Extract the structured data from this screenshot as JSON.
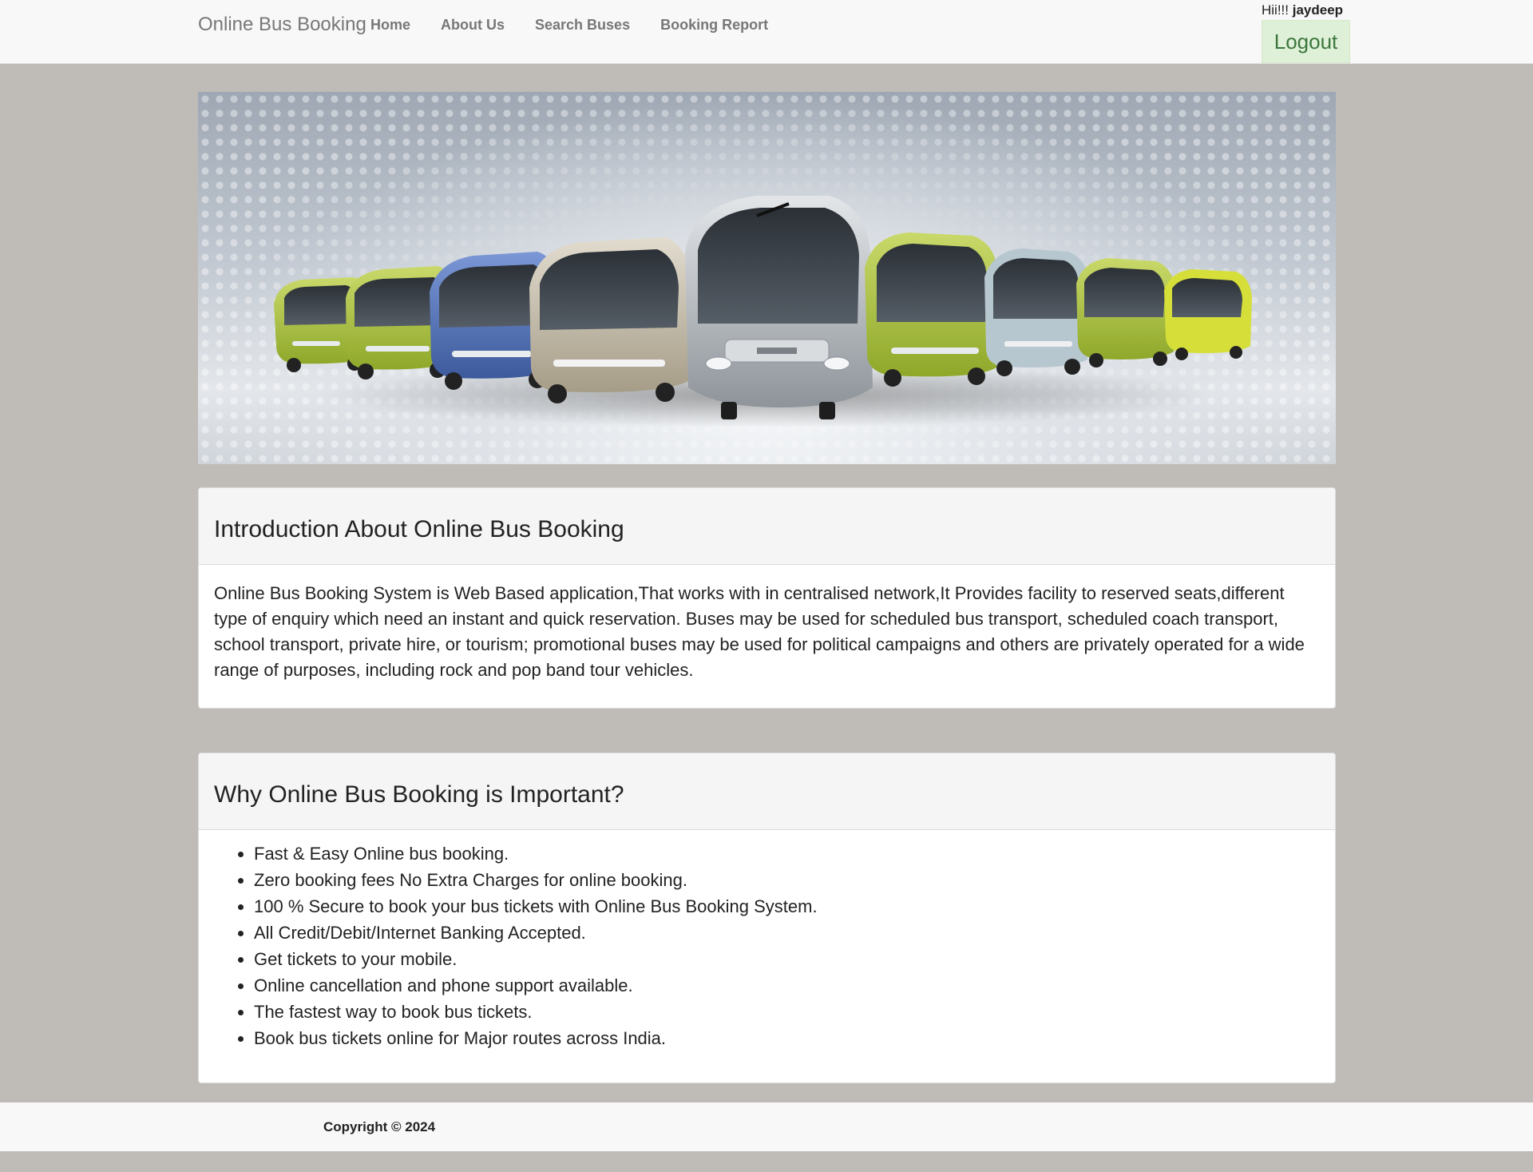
{
  "navbar": {
    "brand": "Online Bus Booking",
    "links": [
      "Home",
      "About Us",
      "Search Buses",
      "Booking Report"
    ],
    "greeting_prefix": "Hii!!!",
    "username": "jaydeep",
    "logout_label": "Logout"
  },
  "banner": {
    "alt": "Fleet of buses"
  },
  "intro": {
    "title": "Introduction About Online Bus Booking",
    "body": "Online Bus Booking System is Web Based application,That works with in centralised network,It Provides facility to reserved seats,different type of enquiry which need an instant and quick reservation. Buses may be used for scheduled bus transport, scheduled coach transport, school transport, private hire, or tourism; promotional buses may be used for political campaigns and others are privately operated for a wide range of purposes, including rock and pop band tour vehicles."
  },
  "why": {
    "title": "Why Online Bus Booking is Important?",
    "items": [
      "Fast & Easy Online bus booking.",
      "Zero booking fees No Extra Charges for online booking.",
      "100 % Secure to book your bus tickets with Online Bus Booking System.",
      "All Credit/Debit/Internet Banking Accepted.",
      "Get tickets to your mobile.",
      "Online cancellation and phone support available.",
      "The fastest way to book bus tickets.",
      "Book bus tickets online for Major routes across India."
    ]
  },
  "footer": {
    "copyright": "Copyright © 2024"
  },
  "colors": {
    "page_background": "#bfbbb7",
    "navbar_background": "#f8f8f8",
    "logout_background": "#dff0d8",
    "logout_text": "#3c763d",
    "bus_lime": "#a8c23a",
    "bus_blue": "#4e6fb5",
    "bus_silver": "#bfc3c7"
  }
}
